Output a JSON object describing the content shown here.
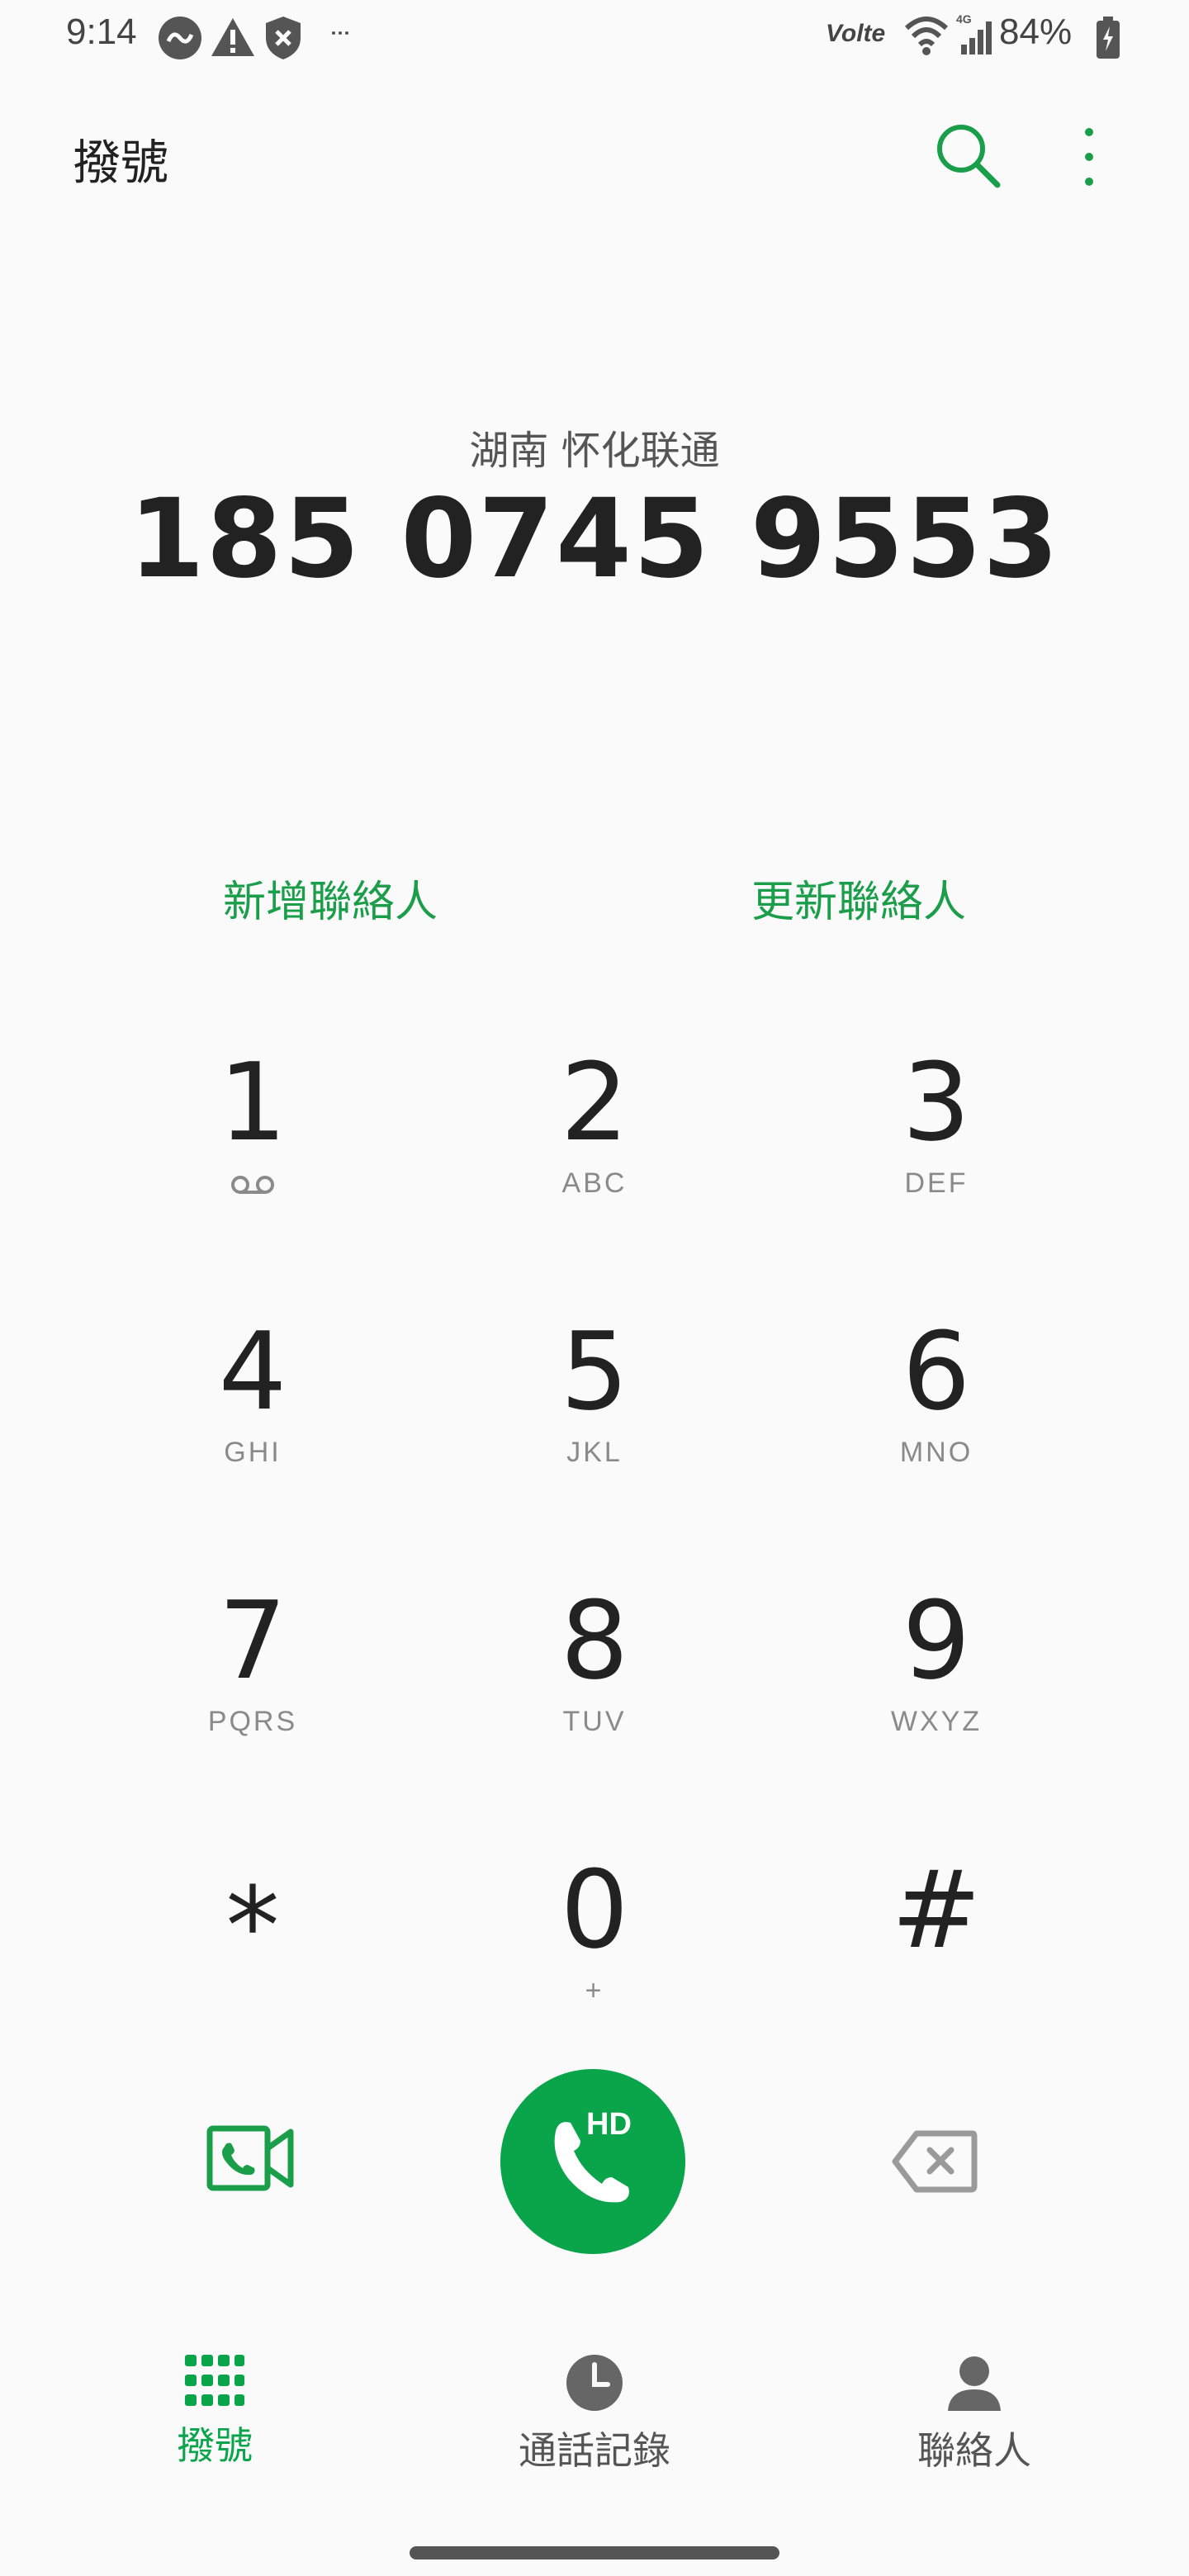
{
  "status_bar": {
    "time": "9:14",
    "network": "Volte",
    "signal_label": "4G",
    "battery": "84%"
  },
  "app_bar": {
    "title": "撥號",
    "search_icon": "search-icon",
    "more_icon": "more-vert-icon"
  },
  "number_display": {
    "location": "湖南 怀化联通",
    "number": "185 0745 9553"
  },
  "contact_actions": {
    "add_contact": "新增聯絡人",
    "update_contact": "更新聯絡人"
  },
  "keypad": [
    {
      "digit": "1",
      "letters": ""
    },
    {
      "digit": "2",
      "letters": "ABC"
    },
    {
      "digit": "3",
      "letters": "DEF"
    },
    {
      "digit": "4",
      "letters": "GHI"
    },
    {
      "digit": "5",
      "letters": "JKL"
    },
    {
      "digit": "6",
      "letters": "MNO"
    },
    {
      "digit": "7",
      "letters": "PQRS"
    },
    {
      "digit": "8",
      "letters": "TUV"
    },
    {
      "digit": "9",
      "letters": "WXYZ"
    },
    {
      "digit": "*",
      "letters": ""
    },
    {
      "digit": "0",
      "letters": "+"
    },
    {
      "digit": "#",
      "letters": ""
    }
  ],
  "bottom_actions": {
    "video_call_icon": "video-call-icon",
    "call_label": "HD",
    "backspace_icon": "backspace-icon"
  },
  "nav": {
    "items": [
      {
        "label": "撥號",
        "icon": "dialpad-icon",
        "active": true
      },
      {
        "label": "通話記錄",
        "icon": "clock-icon",
        "active": false
      },
      {
        "label": "聯絡人",
        "icon": "person-icon",
        "active": false
      }
    ]
  },
  "colors": {
    "accent": "#0aa44a",
    "text": "#222222",
    "muted": "#8a8a8a"
  }
}
